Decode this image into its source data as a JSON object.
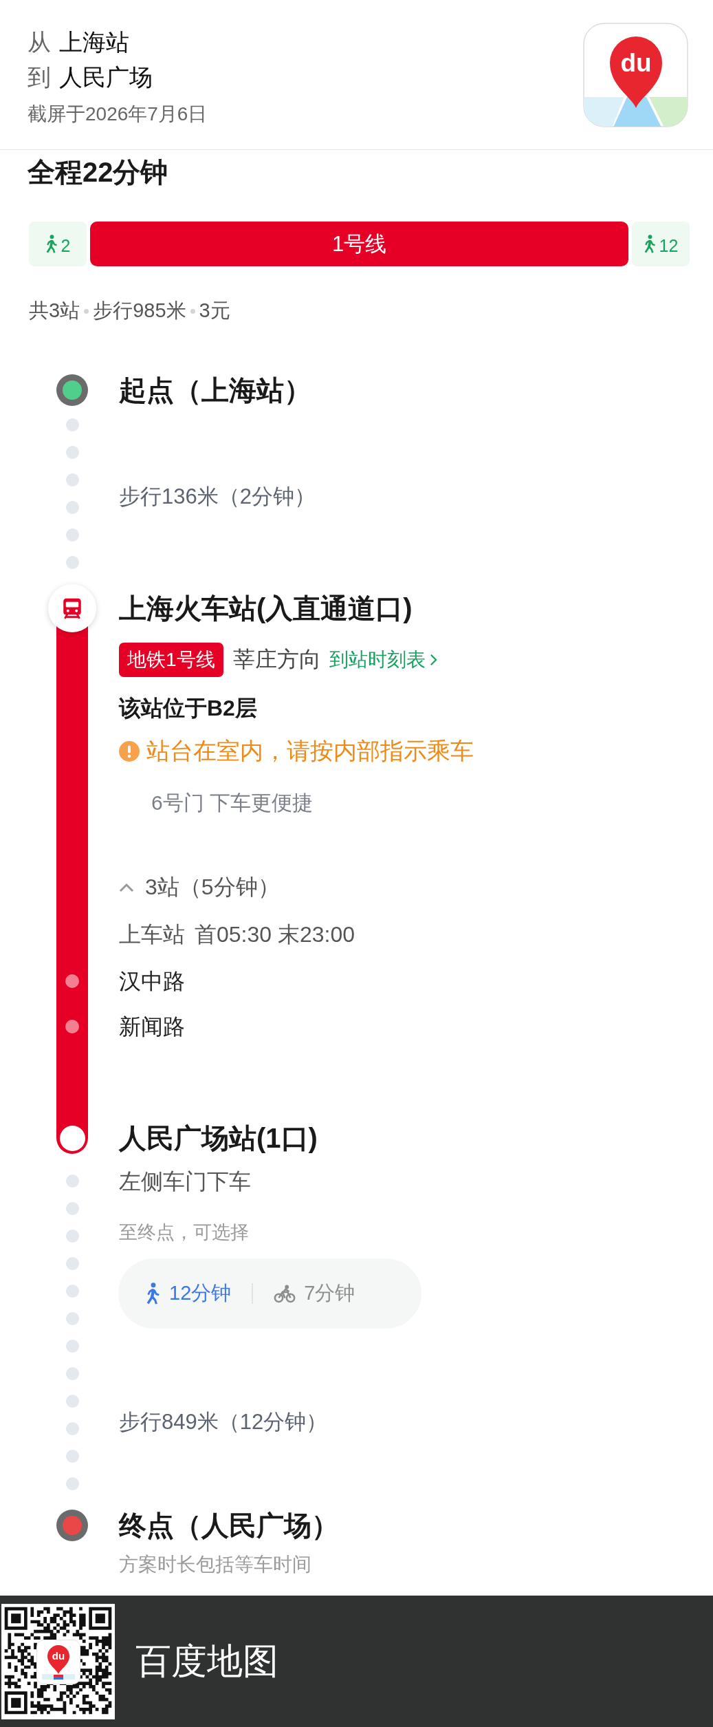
{
  "header": {
    "from_label": "从",
    "from": "上海站",
    "to_label": "到",
    "to": "人民广场",
    "screenshot_date": "截屏于2026年7月6日",
    "app_icon_text": "du"
  },
  "summary": {
    "title": "全程22分钟",
    "segments": [
      {
        "kind": "walk",
        "label": "2"
      },
      {
        "kind": "subway",
        "label": "1号线"
      },
      {
        "kind": "walk",
        "label": "12"
      }
    ],
    "stats": [
      "共3站",
      "步行985米",
      "3元"
    ]
  },
  "origin": {
    "title": "起点（上海站）"
  },
  "walk_to_station": {
    "text": "步行136米（2分钟）"
  },
  "transit": {
    "station": "上海火车站(入直通道口)",
    "line_tag": "地铁1号线",
    "direction": "莘庄方向",
    "timetable_link": "到站时刻表",
    "floor_note": "该站位于B2层",
    "warning": "站台在室内，请按内部指示乘车",
    "door_tip": "6号门 下车更便捷",
    "stops_toggle": {
      "label": "3站（5分钟）",
      "expanded": true
    },
    "boarding": {
      "label": "上车站",
      "times": "首05:30 末23:00"
    },
    "stops": [
      "汉中路",
      "新闻路"
    ],
    "arrival": {
      "station": "人民广场站(1口)",
      "exit_note": "左侧车门下车"
    }
  },
  "last_leg": {
    "prompt": "至终点，可选择",
    "options": [
      {
        "kind": "walk",
        "label": "12分钟",
        "selected": true
      },
      {
        "kind": "bike",
        "label": "7分钟",
        "selected": false
      }
    ],
    "text": "步行849米（12分钟）"
  },
  "destination": {
    "title": "终点（人民广场）",
    "note": "方案时长包括等车时间"
  },
  "footer": {
    "qr_logo_text": "du",
    "brand": "百度地图"
  }
}
